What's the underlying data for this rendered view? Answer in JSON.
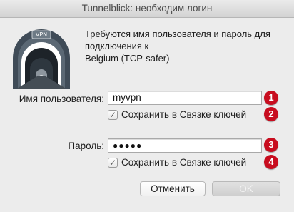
{
  "window": {
    "title": "Tunnelblick: необходим логин"
  },
  "logo": {
    "badge_text": "VPN"
  },
  "message": {
    "line1": "Требуются имя пользователя и пароль для",
    "line2": "подключения к",
    "line3": "Belgium (TCP-safer)"
  },
  "username": {
    "label": "Имя пользователя:",
    "value": "myvpn",
    "save_label": "Сохранить в Связке ключей",
    "save_checked": true,
    "badge": "1",
    "save_badge": "2"
  },
  "password": {
    "label": "Пароль:",
    "value": "●●●●●",
    "save_label": "Сохранить в Связке ключей",
    "save_checked": true,
    "badge": "3",
    "save_badge": "4"
  },
  "buttons": {
    "cancel": "Отменить",
    "ok": "OK"
  },
  "colors": {
    "badge": "#c80d1f",
    "background": "#ececec"
  }
}
